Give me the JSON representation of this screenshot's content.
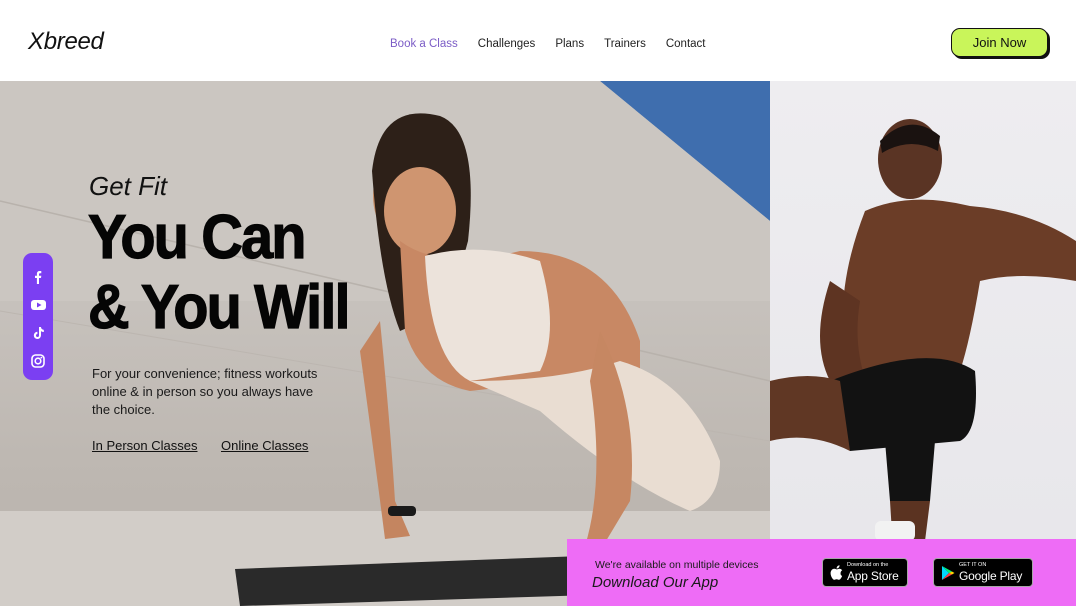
{
  "header": {
    "logo": "Xbreed",
    "nav": [
      "Book a Class",
      "Challenges",
      "Plans",
      "Trainers",
      "Contact"
    ],
    "active_nav": "Book a Class",
    "join_label": "Join Now"
  },
  "hero": {
    "kicker": "Get Fit",
    "headline_line1": "You Can",
    "headline_line2": "& You Will",
    "description": "For your convenience; fitness workouts online & in person so you always have the choice.",
    "links": [
      "In Person Classes",
      "Online Classes"
    ]
  },
  "social": {
    "icons": [
      "facebook-icon",
      "youtube-icon",
      "tiktok-icon",
      "instagram-icon"
    ]
  },
  "app_banner": {
    "small_text": "We're available on multiple devices",
    "big_text": "Download Our App",
    "apple_small": "Download on the",
    "apple_large": "App Store",
    "google_small": "GET IT ON",
    "google_large": "Google Play"
  },
  "colors": {
    "accent_purple": "#7b3ff2",
    "nav_active": "#7b5cc6",
    "join_green": "#c9f55a",
    "banner_pink": "#ee6cf6"
  }
}
